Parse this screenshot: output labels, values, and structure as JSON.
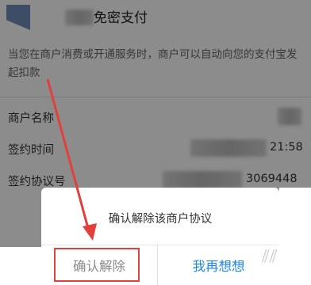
{
  "header": {
    "title": "免密支付"
  },
  "description": "当您在商户消费或开通服务时，商户可以自动向您的支付宝发起扣款",
  "rows": [
    {
      "label": "商户名称",
      "value": ""
    },
    {
      "label": "签约时间",
      "value": "21:58"
    },
    {
      "label": "签约协议号",
      "value": "3069448"
    }
  ],
  "dialog": {
    "message": "确认解除该商户协议",
    "confirm_label": "确认解除",
    "cancel_label": "我再想想"
  },
  "colors": {
    "annotation": "#e2403a",
    "primary": "#1d85e8"
  }
}
